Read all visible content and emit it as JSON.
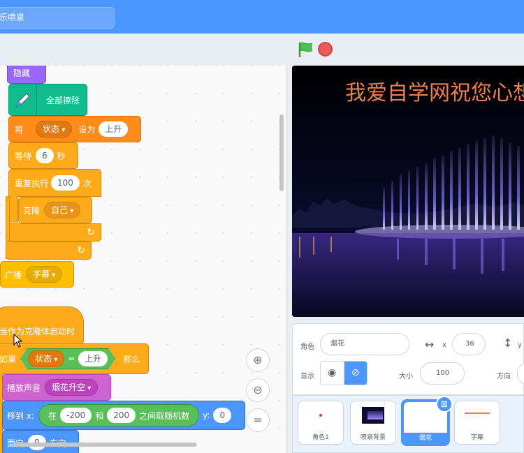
{
  "header": {
    "project_title": "乐喷泉"
  },
  "stage_controls": {
    "flag_icon": "green-flag-icon",
    "stop_icon": "stop-icon"
  },
  "blocks": {
    "hide": "隐藏",
    "pen_clear": "全部擦除",
    "set_var": {
      "word1": "将",
      "var": "状态",
      "word2": "设为",
      "value": "上升"
    },
    "wait": {
      "word1": "等待",
      "value": "6",
      "word2": "秒"
    },
    "repeat": {
      "word1": "重复执行",
      "value": "100",
      "word2": "次"
    },
    "clone": {
      "word": "克隆",
      "target": "自己"
    },
    "broadcast": {
      "word": "广播",
      "message": "字幕"
    },
    "clone_hat": "当作为克隆体启动时",
    "if_block": {
      "word1": "如果",
      "var": "状态",
      "op": "=",
      "value": "上升",
      "word2": "那么"
    },
    "play_sound": {
      "word": "播放声音",
      "sound": "烟花升空"
    },
    "goto": {
      "word1": "移到 x:",
      "word2": "在",
      "from": "-200",
      "and": "和",
      "to": "200",
      "word3": "之间取随机数",
      "ylabel": "y:",
      "yval": "0"
    },
    "point": {
      "word1": "面向",
      "value": "0",
      "word2": "方向"
    }
  },
  "zoom": {
    "in_icon": "zoom-in-icon",
    "out_icon": "zoom-out-icon",
    "reset_icon": "zoom-reset-icon",
    "reset_symbol": "="
  },
  "stage": {
    "caption": "我爱自学网祝您心想"
  },
  "sprite_info": {
    "sprite_label": "角色",
    "sprite_name": "烟花",
    "x_label": "x",
    "x_value": "36",
    "y_label": "y",
    "show_label": "显示",
    "size_label": "大小",
    "size_value": "100",
    "direction_label": "方向"
  },
  "sprites": [
    {
      "name": "角色1"
    },
    {
      "name": "喷泉背景"
    },
    {
      "name": "烟花"
    },
    {
      "name": "字幕"
    }
  ],
  "colors": {
    "accent": "#4c97ff",
    "stage_bg": "#000000",
    "caption": "#ee7e4f"
  }
}
